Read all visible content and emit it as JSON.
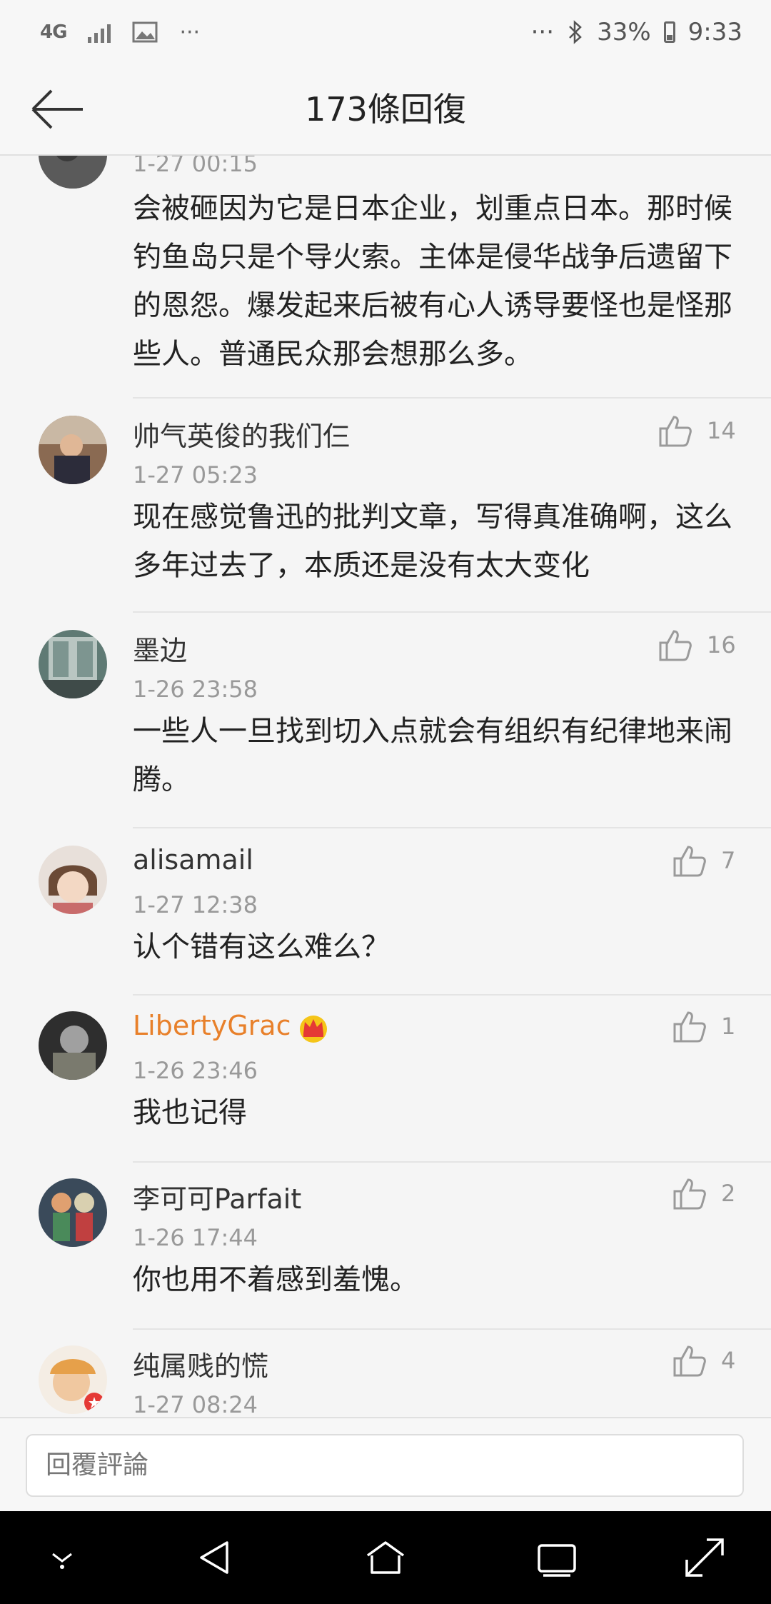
{
  "status_bar": {
    "network": "4G",
    "overflow": "···",
    "overflow_right": "···",
    "battery": "33%",
    "time": "9:33"
  },
  "header": {
    "title": "173條回復"
  },
  "comments": [
    {
      "name": "",
      "time": "1-27 00:15",
      "text": "会被砸因为它是日本企业，划重点日本。那时候钓鱼岛只是个导火索。主体是侵华战争后遗留下的恩怨。爆发起来后被有心人诱导要怪也是怪那些人。普通民众那会想那么多。",
      "likes": ""
    },
    {
      "name": "帅气英俊的我们仨",
      "time": "1-27 05:23",
      "text": "现在感觉鲁迅的批判文章，写得真准确啊，这么多年过去了，本质还是没有太大变化",
      "likes": "14"
    },
    {
      "name": "墨边",
      "time": "1-26 23:58",
      "text": "一些人一旦找到切入点就会有组织有纪律地来闹腾。",
      "likes": "16"
    },
    {
      "name": "alisamail",
      "time": "1-27 12:38",
      "text": "认个错有这么难么？",
      "likes": "7"
    },
    {
      "name": "LibertyGrac",
      "time": "1-26 23:46",
      "text": "我也记得",
      "likes": "1"
    },
    {
      "name": "李可可Parfait",
      "time": "1-26 17:44",
      "text": "你也用不着感到羞愧。",
      "likes": "2"
    },
    {
      "name": "纯属贱的慌",
      "time": "1-27 08:24",
      "text": "",
      "likes": "4"
    }
  ],
  "reply": {
    "placeholder": "回覆評論"
  },
  "colors": {
    "vip_name": "#e8802a",
    "accent_badge": "#e53935"
  },
  "icons": [
    "back-arrow-icon",
    "thumbs-up-icon",
    "crown-badge-icon",
    "nav-down-icon",
    "nav-back-icon",
    "nav-home-icon",
    "nav-recents-icon",
    "nav-expand-icon"
  ]
}
